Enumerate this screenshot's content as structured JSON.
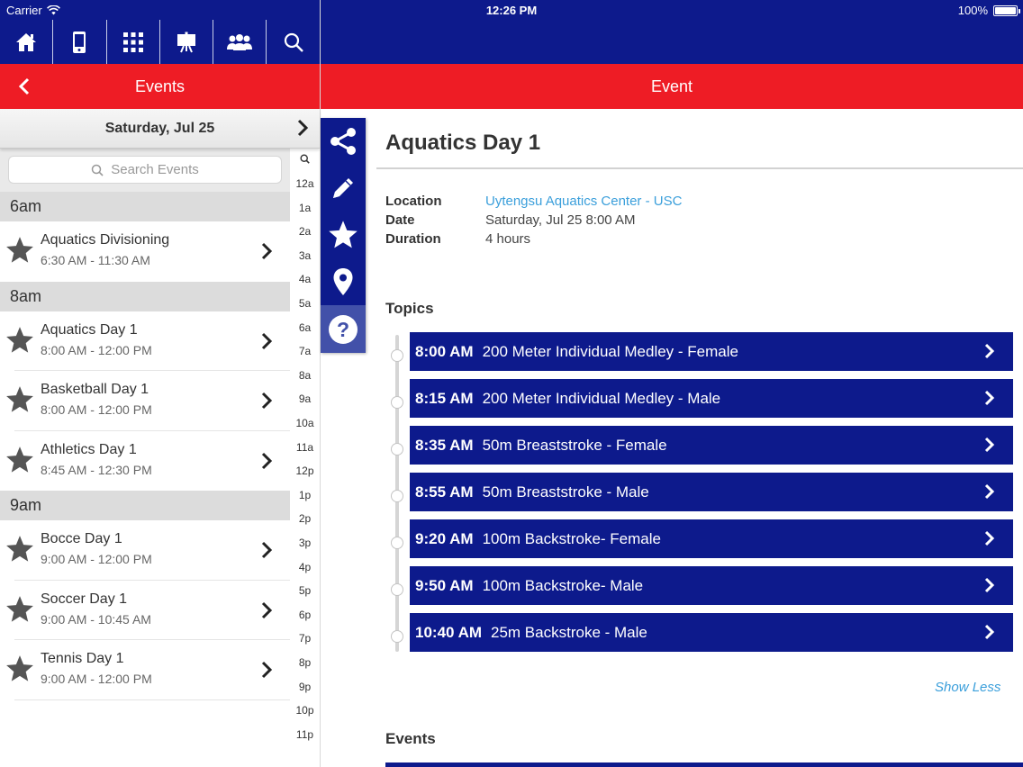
{
  "status_bar": {
    "carrier": "Carrier",
    "time": "12:26 PM",
    "battery": "100%"
  },
  "nav_icons": [
    "home-icon",
    "phone-icon",
    "grid-icon",
    "easel-icon",
    "group-icon",
    "search-icon"
  ],
  "left_header": {
    "title": "Events"
  },
  "right_header": {
    "title": "Event"
  },
  "date_bar": {
    "label": "Saturday, Jul 25"
  },
  "search": {
    "placeholder": "Search Events"
  },
  "schedule": [
    {
      "header": "6am",
      "events": [
        {
          "title": "Aquatics Divisioning",
          "time": "6:30 AM - 11:30 AM"
        }
      ]
    },
    {
      "header": "8am",
      "events": [
        {
          "title": "Aquatics Day 1",
          "time": "8:00 AM - 12:00 PM"
        },
        {
          "title": "Basketball Day 1",
          "time": "8:00 AM - 12:00 PM"
        },
        {
          "title": "Athletics Day 1",
          "time": "8:45 AM - 12:30 PM"
        }
      ]
    },
    {
      "header": "9am",
      "events": [
        {
          "title": "Bocce Day 1",
          "time": "9:00 AM - 12:00 PM"
        },
        {
          "title": "Soccer Day 1",
          "time": "9:00 AM - 10:45 AM"
        },
        {
          "title": "Tennis Day 1",
          "time": "9:00 AM - 12:00 PM"
        }
      ]
    }
  ],
  "hour_index": [
    "12a",
    "1a",
    "2a",
    "3a",
    "4a",
    "5a",
    "6a",
    "7a",
    "8a",
    "9a",
    "10a",
    "11a",
    "12p",
    "1p",
    "2p",
    "3p",
    "4p",
    "5p",
    "6p",
    "7p",
    "8p",
    "9p",
    "10p",
    "11p"
  ],
  "actions": [
    "share-icon",
    "pencil-icon",
    "star-icon",
    "map-pin-icon",
    "help-icon"
  ],
  "event": {
    "title": "Aquatics Day 1",
    "location_label": "Location",
    "location": "Uytengsu Aquatics Center - USC",
    "date_label": "Date",
    "date": "Saturday, Jul 25 8:00 AM",
    "duration_label": "Duration",
    "duration": "4 hours"
  },
  "topics_heading": "Topics",
  "topics": [
    {
      "time": "8:00 AM",
      "name": "200 Meter Individual Medley - Female"
    },
    {
      "time": "8:15 AM",
      "name": "200 Meter Individual Medley - Male"
    },
    {
      "time": "8:35 AM",
      "name": "50m Breaststroke - Female"
    },
    {
      "time": "8:55 AM",
      "name": "50m Breaststroke - Male"
    },
    {
      "time": "9:20 AM",
      "name": "100m Backstroke- Female"
    },
    {
      "time": "9:50 AM",
      "name": "100m Backstroke- Male"
    },
    {
      "time": "10:40 AM",
      "name": "25m Backstroke - Male"
    }
  ],
  "show_less": "Show Less",
  "events_heading": "Events",
  "colors": {
    "navy": "#0d1a8c",
    "red": "#ee1c25",
    "link": "#3b9fdb"
  }
}
